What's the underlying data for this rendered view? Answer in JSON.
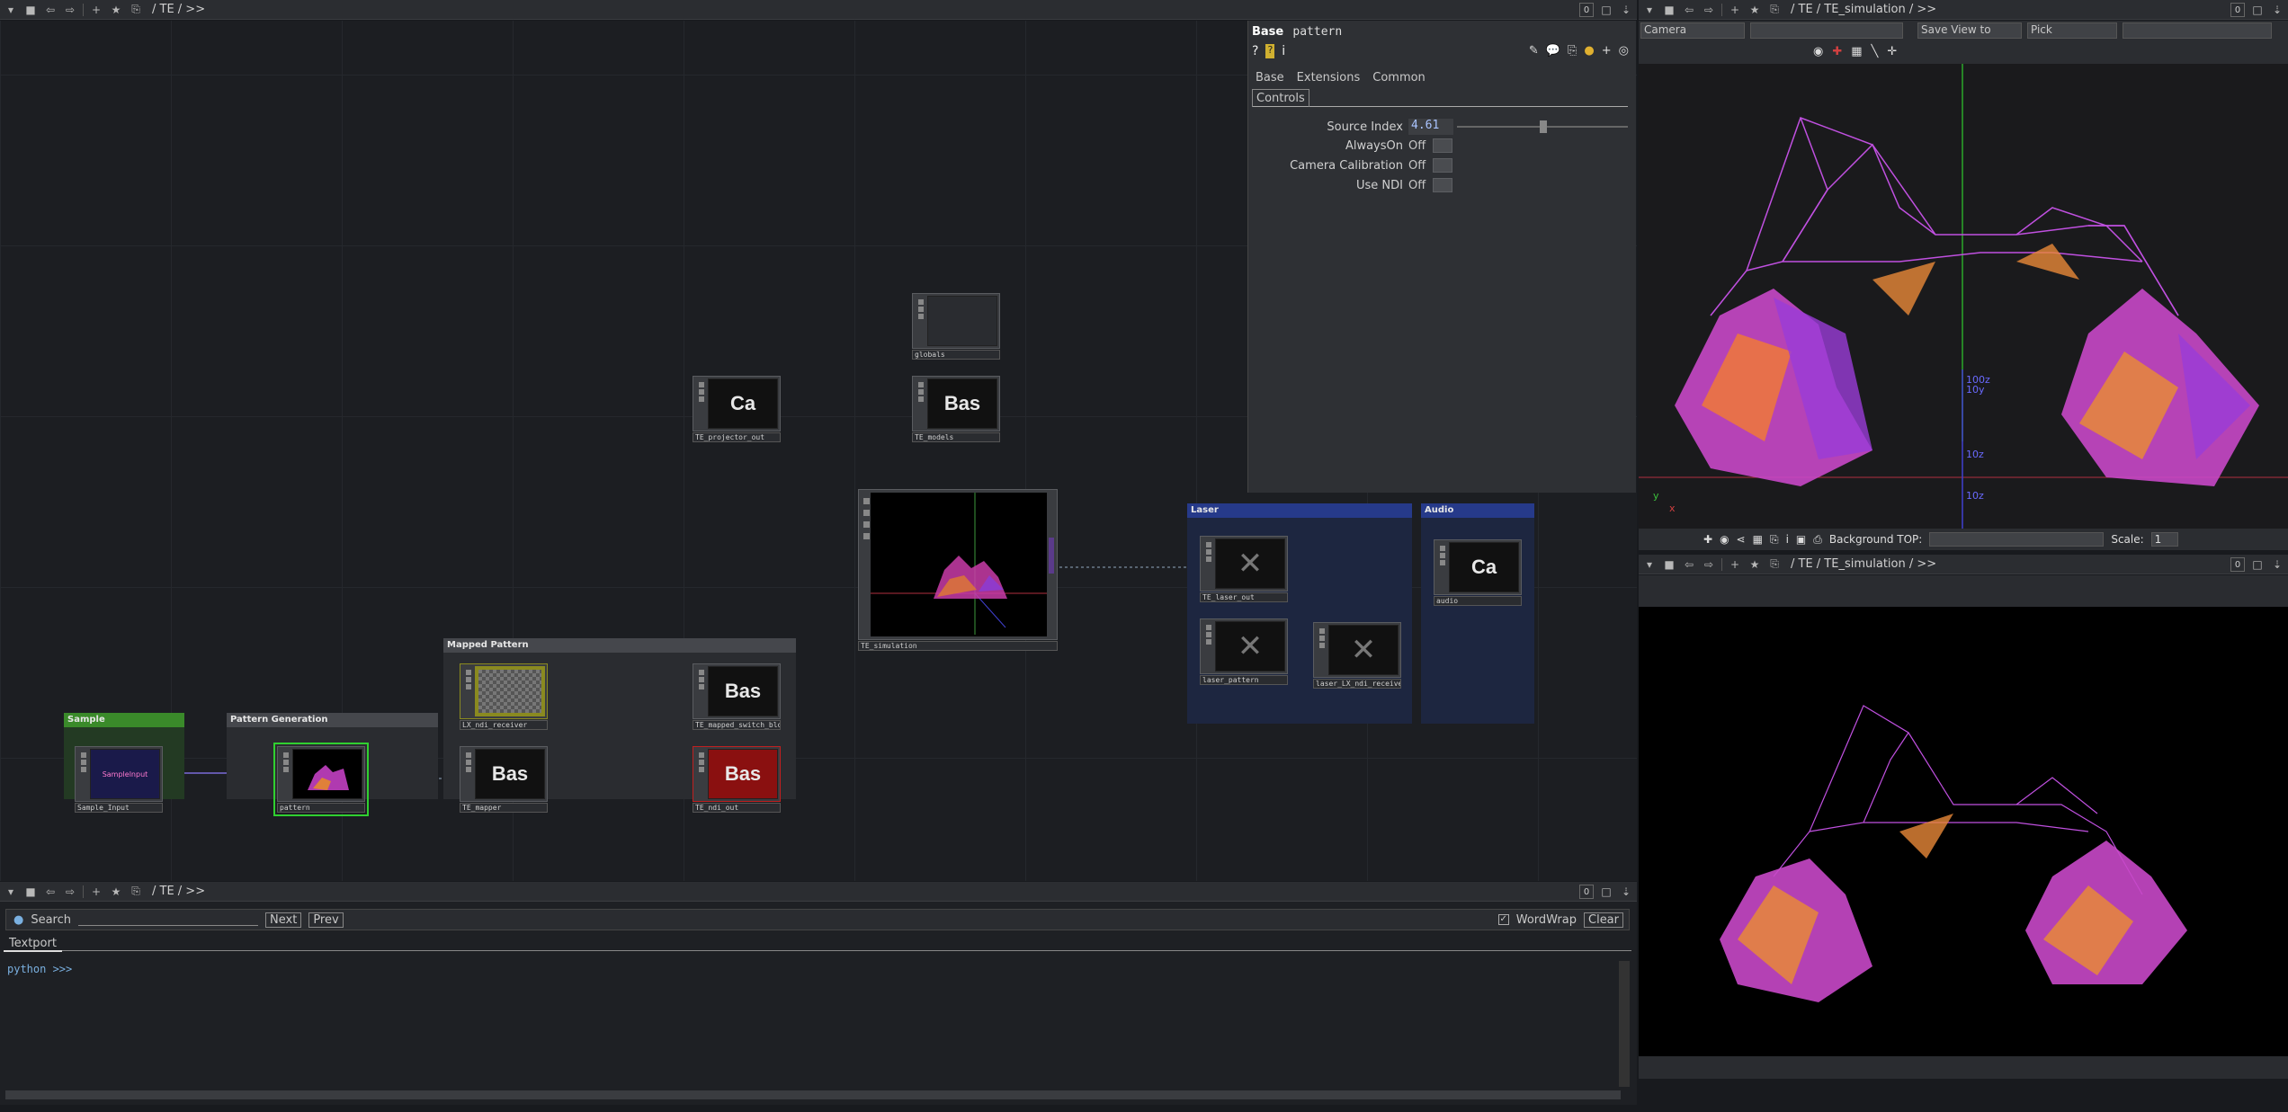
{
  "top_network_bar": {
    "path": "/ TE / >>",
    "num": "0"
  },
  "top_viewer_bar": {
    "path": "/ TE / TE_simulation / >>",
    "num": "0"
  },
  "bottom_viewer_bar": {
    "path": "/ TE / TE_simulation / >>",
    "num": "0"
  },
  "textport_bar": {
    "path": "/ TE / >>",
    "num": "0"
  },
  "viewer_toolbar": {
    "camera": "Camera",
    "save_view": "Save View to",
    "pick": "Pick"
  },
  "viewer_bottom_toolbar": {
    "bg_label": "Background TOP:",
    "scale_label": "Scale:",
    "scale_value": "1"
  },
  "params": {
    "op_type": "Base",
    "op_name": "pattern",
    "tabs": [
      "Base",
      "Extensions",
      "Common"
    ],
    "subtab": "Controls",
    "rows": [
      {
        "label": "Source Index",
        "value": "4.61"
      },
      {
        "label": "AlwaysOn",
        "value": "Off"
      },
      {
        "label": "Camera Calibration",
        "value": "Off"
      },
      {
        "label": "Use NDI",
        "value": "Off"
      }
    ]
  },
  "groups": {
    "sample": "Sample",
    "pattern_gen": "Pattern Generation",
    "mapped": "Mapped Pattern",
    "laser": "Laser",
    "audio": "Audio"
  },
  "nodes": {
    "globals": "globals",
    "te_models": "TE_models",
    "te_projector_out": "TE_projector_out",
    "te_simulation": "TE_simulation",
    "sample_input": "Sample_Input",
    "pattern": "pattern",
    "lx_ndi_receiver": "LX_ndi_receiver",
    "te_mapper": "TE_mapper",
    "te_mapped_switch": "TE_mapped_switch_blo",
    "te_ndi_out": "TE_ndi_out",
    "te_laser_out": "TE_laser_out",
    "laser_pattern": "laser_pattern",
    "laser_lx_ndi": "laser_LX_ndi_receiver",
    "audio": "audio",
    "bas_text": "Bas",
    "ca_text": "Ca",
    "sample_overlay": "Samplelnput"
  },
  "textport": {
    "search_label": "Search",
    "next": "Next",
    "prev": "Prev",
    "wordwrap": "WordWrap",
    "clear": "Clear",
    "tab": "Textport",
    "prompt": "python >>>"
  },
  "axis_labels": {
    "a": "100z",
    "b": "10y",
    "c": "10z",
    "d": "10z",
    "y": "y",
    "x": "x"
  }
}
